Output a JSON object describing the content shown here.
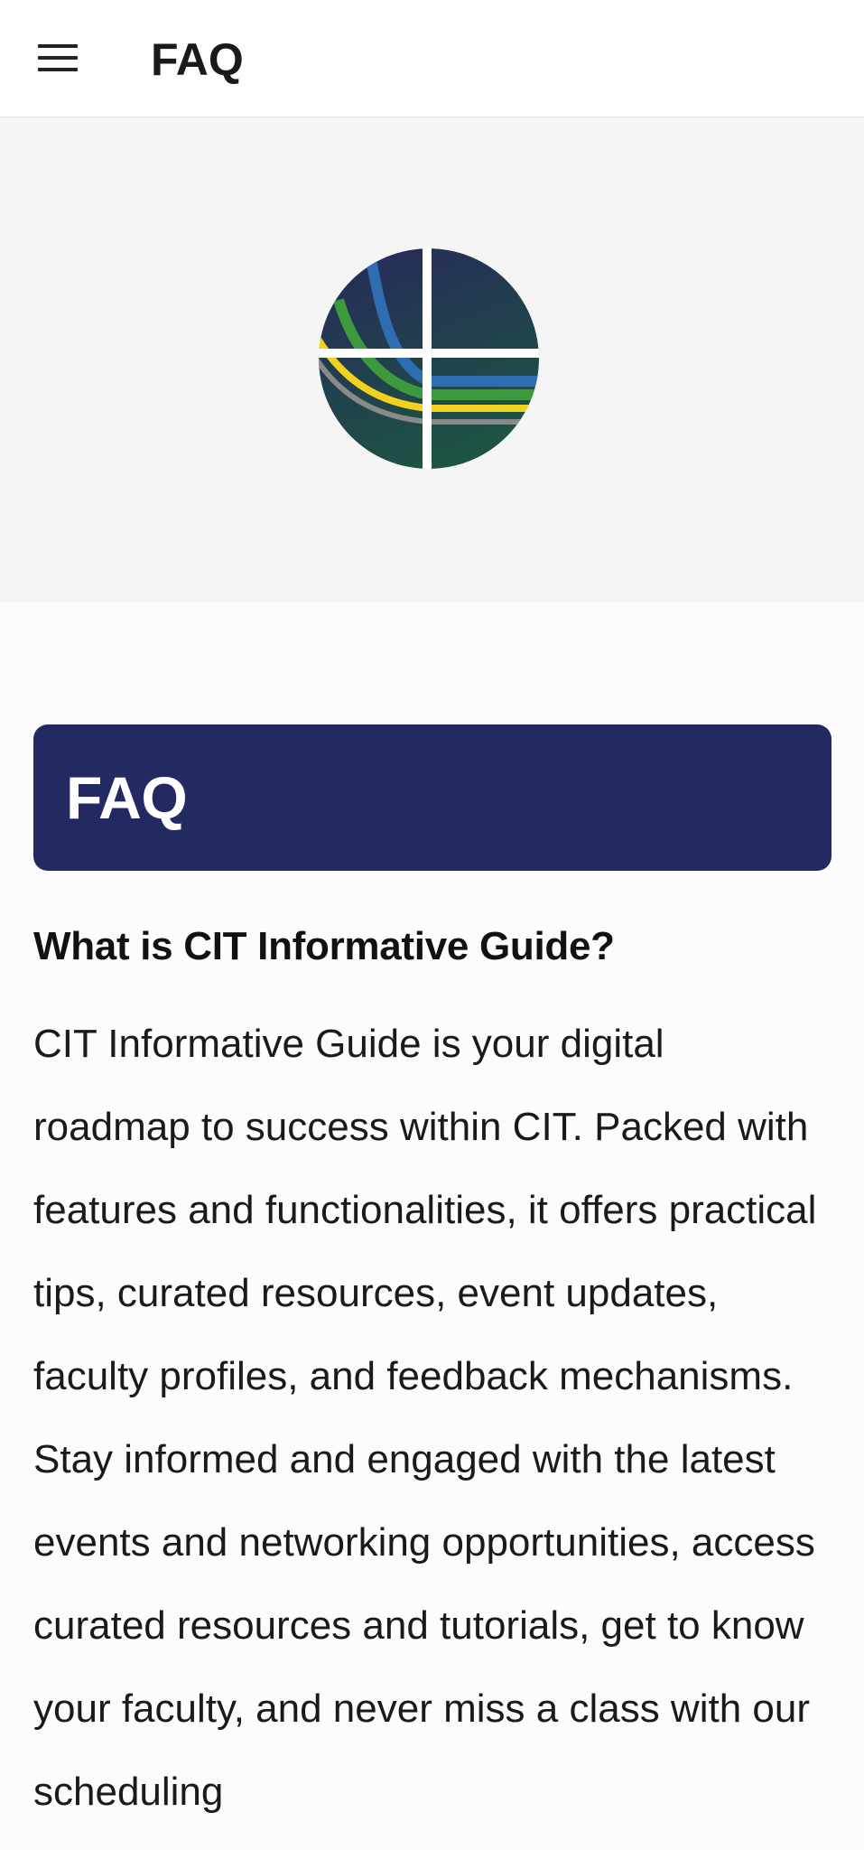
{
  "app_bar": {
    "title": "FAQ",
    "menu_icon": "hamburger-menu-icon"
  },
  "hero": {
    "logo": "cit-logo"
  },
  "faq": {
    "banner_title": "FAQ",
    "items": [
      {
        "question": "What is CIT Informative Guide?",
        "answer": "CIT Informative Guide is your digital roadmap to success within CIT. Packed with features and functionalities, it offers practical tips, curated resources, event updates, faculty profiles, and feedback mechanisms. Stay informed and engaged with the latest events and networking opportunities, access curated resources and tutorials, get to know your faculty, and never miss a class with our scheduling"
      }
    ]
  },
  "colors": {
    "banner": "#232a62",
    "hero_background": "#f5f5f5",
    "page_background": "#fcfcfc"
  }
}
